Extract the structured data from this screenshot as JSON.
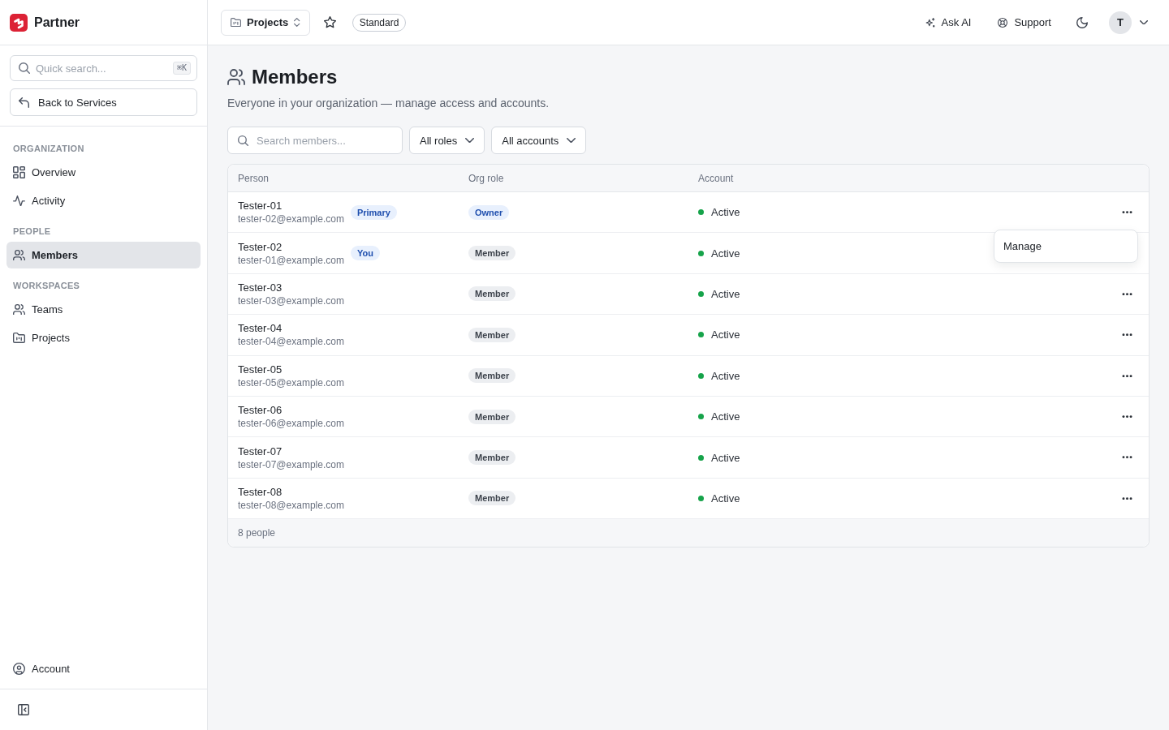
{
  "sidebar": {
    "brand": "Partner",
    "search": {
      "placeholder": "Quick search...",
      "shortcut": "⌘K"
    },
    "back_button": "Back to Services",
    "sections": [
      {
        "title": "ORGANIZATION",
        "items": [
          {
            "label": "Overview",
            "selected": false
          },
          {
            "label": "Activity",
            "selected": false
          }
        ]
      },
      {
        "title": "PEOPLE",
        "items": [
          {
            "label": "Members",
            "selected": true
          }
        ]
      },
      {
        "title": "WORKSPACES",
        "items": [
          {
            "label": "Teams",
            "selected": false
          },
          {
            "label": "Projects",
            "selected": false
          }
        ]
      }
    ],
    "footer_item": "Account"
  },
  "topbar": {
    "project_switcher": "Projects",
    "starred": false,
    "plan": "Standard",
    "actions": [
      "Ask AI",
      "Support"
    ],
    "avatar": "T"
  },
  "page": {
    "title": "Members",
    "description": "Everyone in your organization — manage access and accounts.",
    "search": {
      "placeholder": "Search members..."
    },
    "filters": [
      "All roles",
      "All accounts"
    ]
  },
  "table": {
    "columns": [
      "Person",
      "Org role",
      "Account"
    ],
    "rows": [
      {
        "name": "Tester-01",
        "email": "tester-02@example.com",
        "tag": "Primary",
        "role": {
          "label": "Owner",
          "kind": "owner"
        },
        "status": {
          "label": "Active",
          "color": "#16a34a"
        },
        "menu_open": true
      },
      {
        "name": "Tester-02",
        "email": "tester-01@example.com",
        "tag": "You",
        "role": {
          "label": "Member",
          "kind": "member"
        },
        "status": {
          "label": "Active",
          "color": "#16a34a"
        },
        "menu_open": false
      },
      {
        "name": "Tester-03",
        "email": "tester-03@example.com",
        "role": {
          "label": "Member",
          "kind": "member"
        },
        "status": {
          "label": "Active",
          "color": "#16a34a"
        },
        "menu_open": false
      },
      {
        "name": "Tester-04",
        "email": "tester-04@example.com",
        "role": {
          "label": "Member",
          "kind": "member"
        },
        "status": {
          "label": "Active",
          "color": "#16a34a"
        },
        "menu_open": false
      },
      {
        "name": "Tester-05",
        "email": "tester-05@example.com",
        "role": {
          "label": "Member",
          "kind": "member"
        },
        "status": {
          "label": "Active",
          "color": "#16a34a"
        },
        "menu_open": false
      },
      {
        "name": "Tester-06",
        "email": "tester-06@example.com",
        "role": {
          "label": "Member",
          "kind": "member"
        },
        "status": {
          "label": "Active",
          "color": "#16a34a"
        },
        "menu_open": false
      },
      {
        "name": "Tester-07",
        "email": "tester-07@example.com",
        "role": {
          "label": "Member",
          "kind": "member"
        },
        "status": {
          "label": "Active",
          "color": "#16a34a"
        },
        "menu_open": false
      },
      {
        "name": "Tester-08",
        "email": "tester-08@example.com",
        "role": {
          "label": "Member",
          "kind": "member"
        },
        "status": {
          "label": "Active",
          "color": "#16a34a"
        },
        "menu_open": false
      }
    ],
    "menu_items": [
      "Manage"
    ],
    "footer": "8 people"
  }
}
